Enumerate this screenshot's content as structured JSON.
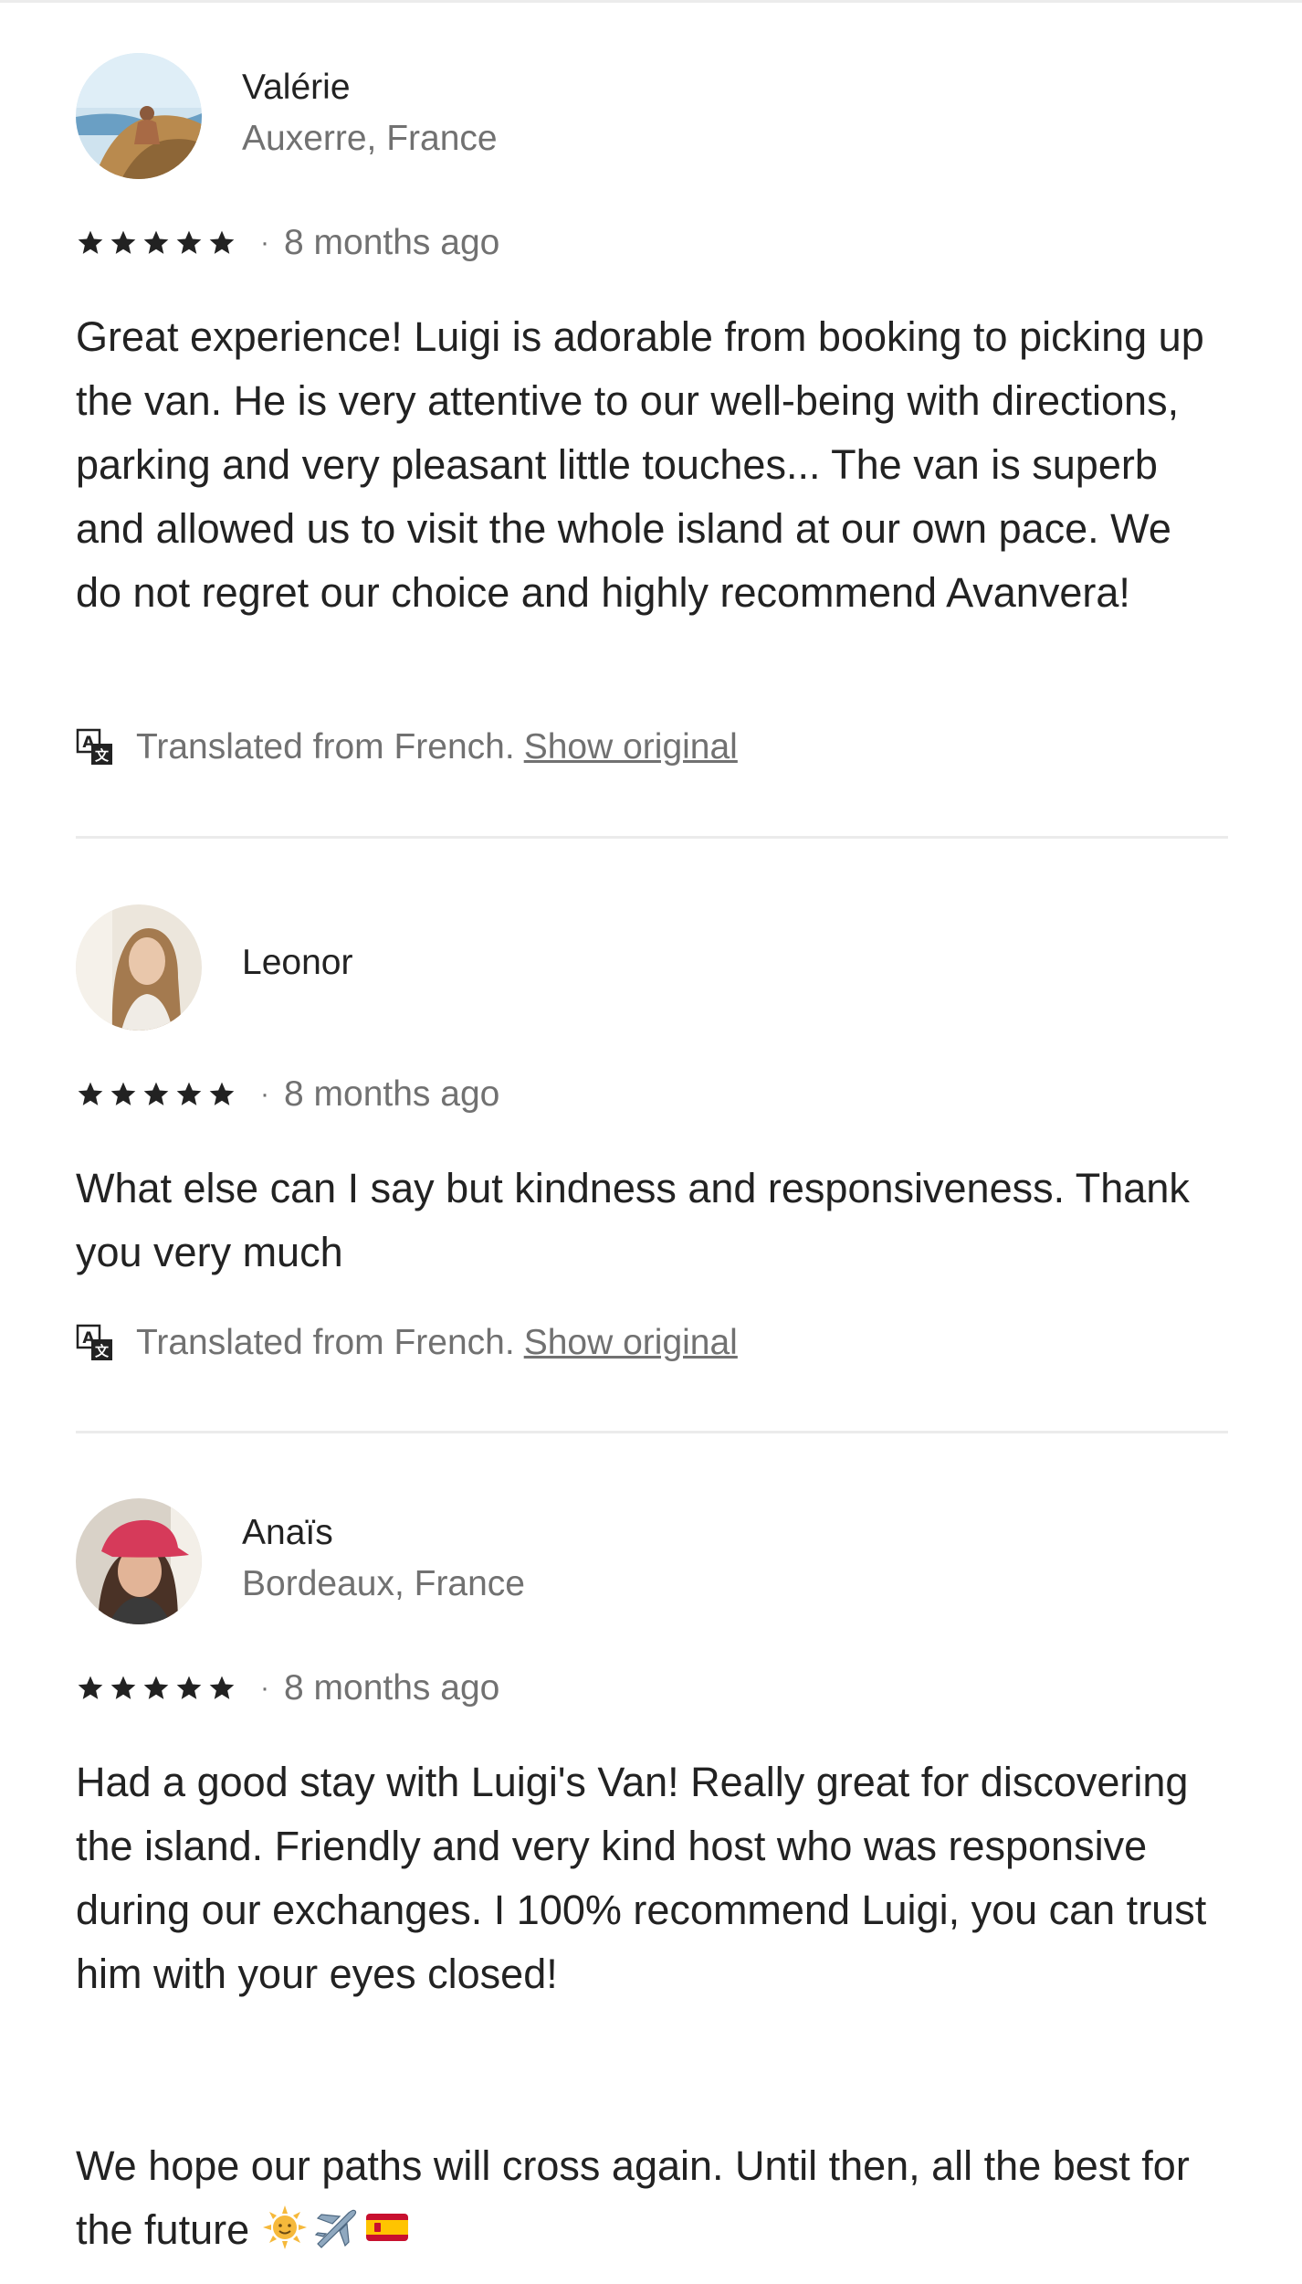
{
  "reviews": [
    {
      "name": "Valérie",
      "location": "Auxerre, France",
      "rating": 5,
      "date": "8 months ago",
      "text": "Great experience! Luigi is adorable from booking to picking up the van. He is very attentive to our well-being with directions, parking and very pleasant little touches... The van is superb and allowed us to visit the whole island at our own pace. We do not regret our choice and highly recommend Avanvera!",
      "translated_note": "Translated from French.",
      "show_original": "Show original"
    },
    {
      "name": "Leonor",
      "location": "",
      "rating": 5,
      "date": "8 months ago",
      "text": "What else can I say but kindness and responsiveness. Thank you very much",
      "translated_note": "Translated from French.",
      "show_original": "Show original"
    },
    {
      "name": "Anaïs",
      "location": "Bordeaux, France",
      "rating": 5,
      "date": "8 months ago",
      "text_para1": "Had a good stay with Luigi's Van! Really great for discovering the island. Friendly and very kind host who was responsive during our exchanges. I 100% recommend Luigi, you can trust him with your eyes closed!",
      "text_para2": "We hope our paths will cross again. Until then, all the best for the future",
      "emojis": [
        "sun-emoji",
        "airplane-emoji",
        "spain-flag-emoji"
      ]
    }
  ],
  "separator_dot": "·",
  "icons": {
    "star": "star-icon",
    "translate": "translate-icon"
  },
  "colors": {
    "text_primary": "#222222",
    "text_secondary": "#717171",
    "divider": "#ebebeb"
  }
}
